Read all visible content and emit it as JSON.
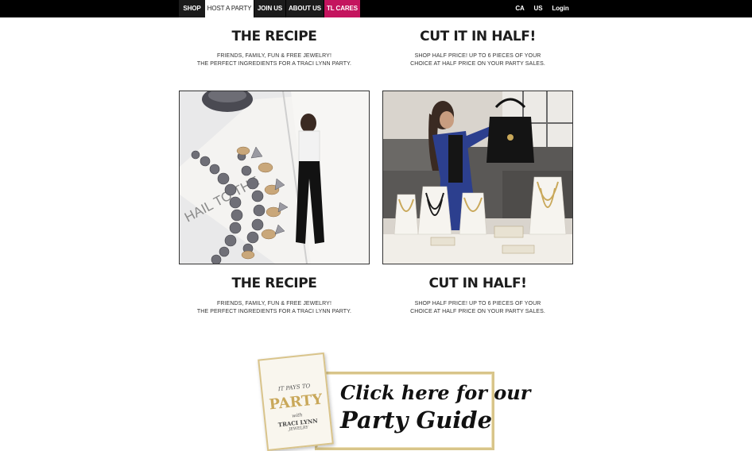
{
  "nav": {
    "left_items": [
      "SHOP",
      "HOST A PARTY",
      "JOIN US",
      "ABOUT US",
      "TL CARES"
    ],
    "right_items": [
      "CA",
      "US",
      "Login"
    ],
    "active": "HOST A PARTY",
    "accent_color": "#c4145e"
  },
  "section_top": {
    "left": {
      "title": "THE RECIPE",
      "lines": [
        "FRIENDS, FAMILY, FUN & FREE JEWELRY!",
        "THE PERFECT INGREDIENTS FOR A TRACI LYNN PARTY."
      ]
    },
    "right": {
      "title": "CUT IT IN HALF!",
      "lines": [
        "SHOP HALF PRICE! UP TO 6 PIECES OF YOUR",
        "CHOICE AT HALF PRICE ON YOUR PARTY SALES."
      ]
    }
  },
  "section_bottom": {
    "left": {
      "title": "THE RECIPE",
      "lines": [
        "FRIENDS, FAMILY, FUN & FREE JEWELRY!",
        "THE PERFECT INGREDIENTS FOR A TRACI LYNN PARTY."
      ]
    },
    "right": {
      "title": "CUT IN HALF!",
      "lines": [
        "SHOP HALF PRICE! UP TO 6 PIECES OF YOUR",
        "CHOICE AT HALF PRICE ON YOUR PARTY SALES."
      ]
    }
  },
  "images": {
    "left_magazine_text": "HAIL TO THE"
  },
  "guide": {
    "line1": "Click here for our",
    "line2": "Party Guide",
    "card": {
      "it_pays_to": "IT PAYS TO",
      "party": "PARTY",
      "with": "with",
      "brand": "TRACI LYNN",
      "jewelry": "JEWELRY"
    }
  }
}
